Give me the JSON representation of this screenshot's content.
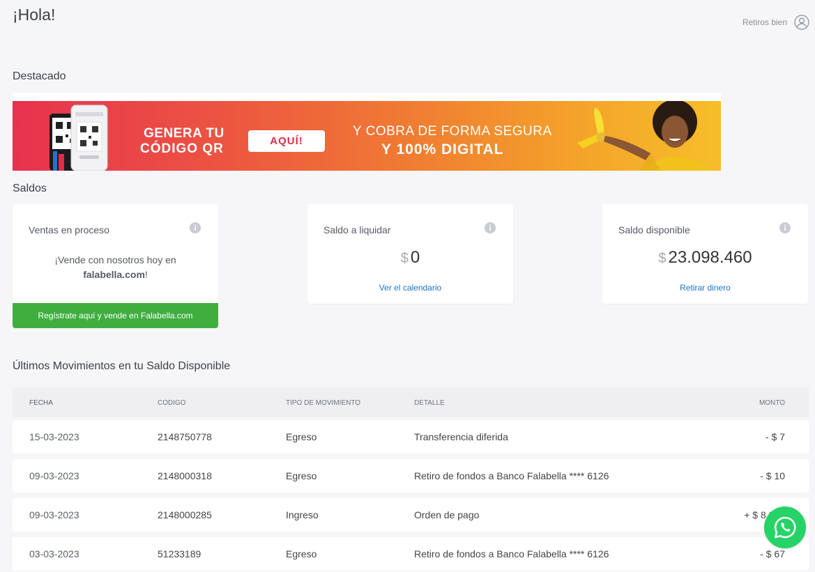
{
  "header": {
    "greeting": "¡Hola!",
    "user_name": "Retiros bien",
    "user_icon": "user-circle-icon"
  },
  "featured": {
    "title": "Destacado",
    "banner": {
      "line1": "GENERA TU",
      "line2": "CÓDIGO QR",
      "button": "AQUÍ!",
      "line3": "Y COBRA DE FORMA SEGURA",
      "line4": "Y 100% DIGITAL"
    }
  },
  "balances": {
    "title": "Saldos",
    "cards": [
      {
        "title": "Ventas en proceso",
        "message_line1": "¡Vende con nosotros hoy en",
        "message_brand": "falabella.com",
        "message_end": "!",
        "button": "Regístrate aquí y vende en Falabella.com"
      },
      {
        "title": "Saldo a liquidar",
        "currency": "$",
        "amount": "0",
        "link": "Ver el calendario"
      },
      {
        "title": "Saldo disponible",
        "currency": "$",
        "amount": "23.098.460",
        "link": "Retirar dinero"
      }
    ]
  },
  "movements": {
    "title": "Últimos Movimientos en tu Saldo Disponible",
    "columns": [
      "Fecha",
      "Codigo",
      "Tipo de movimiento",
      "Detalle",
      "Monto"
    ],
    "rows": [
      {
        "fecha": "15-03-2023",
        "codigo": "2148750778",
        "tipo": "Egreso",
        "detalle": "Transferencia diferida",
        "monto": "- $ 7"
      },
      {
        "fecha": "09-03-2023",
        "codigo": "2148000318",
        "tipo": "Egreso",
        "detalle": "Retiro de fondos a Banco Falabella **** 6126",
        "monto": "- $ 10"
      },
      {
        "fecha": "09-03-2023",
        "codigo": "2148000285",
        "tipo": "Ingreso",
        "detalle": "Orden de pago",
        "monto": "+ $ 8.000"
      },
      {
        "fecha": "03-03-2023",
        "codigo": "51233189",
        "tipo": "Egreso",
        "detalle": "Retiro de fondos a Banco Falabella **** 6126",
        "monto": "- $ 67"
      }
    ]
  },
  "colors": {
    "primary_link": "#1a73c8",
    "green": "#3fae3f",
    "whatsapp": "#25d366"
  }
}
